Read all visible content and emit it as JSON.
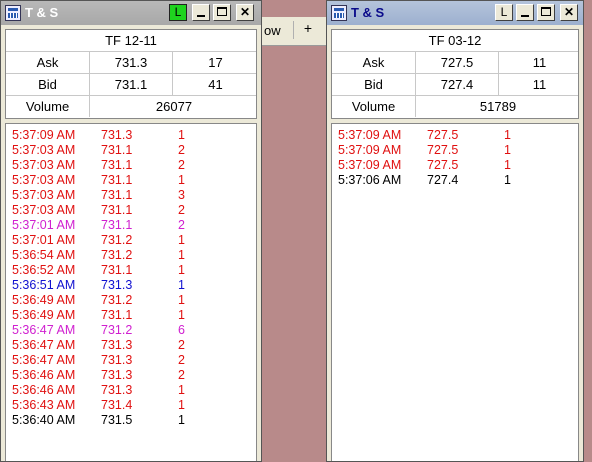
{
  "background": {
    "fragment_text": "ow",
    "plus_label": "+"
  },
  "colors": {
    "up_tick": "#e01010",
    "mid_tick": "#d020d0",
    "bid_tick": "#1010d0",
    "neutral": "#000000",
    "link_active": "#1fd41f"
  },
  "windows": [
    {
      "title": "T & S",
      "link_label": "L",
      "contract": "TF 12-11",
      "ask_label": "Ask",
      "ask_price": "731.3",
      "ask_size": "17",
      "bid_label": "Bid",
      "bid_price": "731.1",
      "bid_size": "41",
      "volume_label": "Volume",
      "volume": "26077",
      "trades": [
        {
          "time": "5:37:09 AM",
          "price": "731.3",
          "size": "1",
          "color": "#e01010"
        },
        {
          "time": "5:37:03 AM",
          "price": "731.1",
          "size": "2",
          "color": "#e01010"
        },
        {
          "time": "5:37:03 AM",
          "price": "731.1",
          "size": "2",
          "color": "#e01010"
        },
        {
          "time": "5:37:03 AM",
          "price": "731.1",
          "size": "1",
          "color": "#e01010"
        },
        {
          "time": "5:37:03 AM",
          "price": "731.1",
          "size": "3",
          "color": "#e01010"
        },
        {
          "time": "5:37:03 AM",
          "price": "731.1",
          "size": "2",
          "color": "#e01010"
        },
        {
          "time": "5:37:01 AM",
          "price": "731.1",
          "size": "2",
          "color": "#d020d0"
        },
        {
          "time": "5:37:01 AM",
          "price": "731.2",
          "size": "1",
          "color": "#e01010"
        },
        {
          "time": "5:36:54 AM",
          "price": "731.2",
          "size": "1",
          "color": "#e01010"
        },
        {
          "time": "5:36:52 AM",
          "price": "731.1",
          "size": "1",
          "color": "#e01010"
        },
        {
          "time": "5:36:51 AM",
          "price": "731.3",
          "size": "1",
          "color": "#1010d0"
        },
        {
          "time": "5:36:49 AM",
          "price": "731.2",
          "size": "1",
          "color": "#e01010"
        },
        {
          "time": "5:36:49 AM",
          "price": "731.1",
          "size": "1",
          "color": "#e01010"
        },
        {
          "time": "5:36:47 AM",
          "price": "731.2",
          "size": "6",
          "color": "#d020d0"
        },
        {
          "time": "5:36:47 AM",
          "price": "731.3",
          "size": "2",
          "color": "#e01010"
        },
        {
          "time": "5:36:47 AM",
          "price": "731.3",
          "size": "2",
          "color": "#e01010"
        },
        {
          "time": "5:36:46 AM",
          "price": "731.3",
          "size": "2",
          "color": "#e01010"
        },
        {
          "time": "5:36:46 AM",
          "price": "731.3",
          "size": "1",
          "color": "#e01010"
        },
        {
          "time": "5:36:43 AM",
          "price": "731.4",
          "size": "1",
          "color": "#e01010"
        },
        {
          "time": "5:36:40 AM",
          "price": "731.5",
          "size": "1",
          "color": "#000000"
        }
      ]
    },
    {
      "title": "T & S",
      "link_label": "L",
      "contract": "TF 03-12",
      "ask_label": "Ask",
      "ask_price": "727.5",
      "ask_size": "11",
      "bid_label": "Bid",
      "bid_price": "727.4",
      "bid_size": "11",
      "volume_label": "Volume",
      "volume": "51789",
      "trades": [
        {
          "time": "5:37:09 AM",
          "price": "727.5",
          "size": "1",
          "color": "#e01010"
        },
        {
          "time": "5:37:09 AM",
          "price": "727.5",
          "size": "1",
          "color": "#e01010"
        },
        {
          "time": "5:37:09 AM",
          "price": "727.5",
          "size": "1",
          "color": "#e01010"
        },
        {
          "time": "5:37:06 AM",
          "price": "727.4",
          "size": "1",
          "color": "#000000"
        }
      ]
    }
  ]
}
